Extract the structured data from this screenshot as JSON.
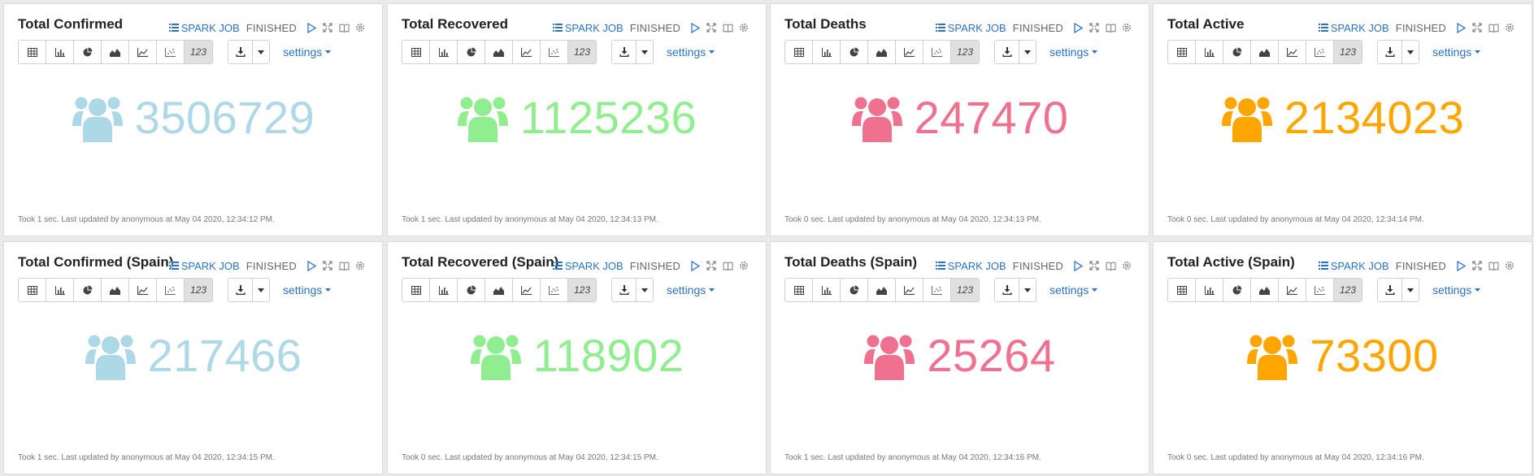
{
  "status": {
    "spark_job": "SPARK JOB",
    "finished": "FINISHED"
  },
  "toolbar": {
    "active_label": "123",
    "settings_label": "settings"
  },
  "colors": {
    "confirmed": "#add8e6",
    "recovered": "#90ee90",
    "deaths": "#f07090",
    "active": "#ffa500",
    "link": "#2a72c4"
  },
  "cards": [
    {
      "title": "Total Confirmed",
      "value": "3506729",
      "color": "#add8e6",
      "footer": "Took 1 sec. Last updated by anonymous at May 04 2020, 12:34:12 PM."
    },
    {
      "title": "Total Recovered",
      "value": "1125236",
      "color": "#90ee90",
      "footer": "Took 1 sec. Last updated by anonymous at May 04 2020, 12:34:13 PM."
    },
    {
      "title": "Total Deaths",
      "value": "247470",
      "color": "#f07090",
      "footer": "Took 0 sec. Last updated by anonymous at May 04 2020, 12:34:13 PM."
    },
    {
      "title": "Total Active",
      "value": "2134023",
      "color": "#ffa500",
      "footer": "Took 0 sec. Last updated by anonymous at May 04 2020, 12:34:14 PM."
    },
    {
      "title": "Total Confirmed (Spain)",
      "value": "217466",
      "color": "#add8e6",
      "footer": "Took 1 sec. Last updated by anonymous at May 04 2020, 12:34:15 PM."
    },
    {
      "title": "Total Recovered (Spain)",
      "value": "118902",
      "color": "#90ee90",
      "footer": "Took 0 sec. Last updated by anonymous at May 04 2020, 12:34:15 PM."
    },
    {
      "title": "Total Deaths (Spain)",
      "value": "25264",
      "color": "#f07090",
      "footer": "Took 1 sec. Last updated by anonymous at May 04 2020, 12:34:16 PM."
    },
    {
      "title": "Total Active (Spain)",
      "value": "73300",
      "color": "#ffa500",
      "footer": "Took 0 sec. Last updated by anonymous at May 04 2020, 12:34:16 PM."
    }
  ]
}
